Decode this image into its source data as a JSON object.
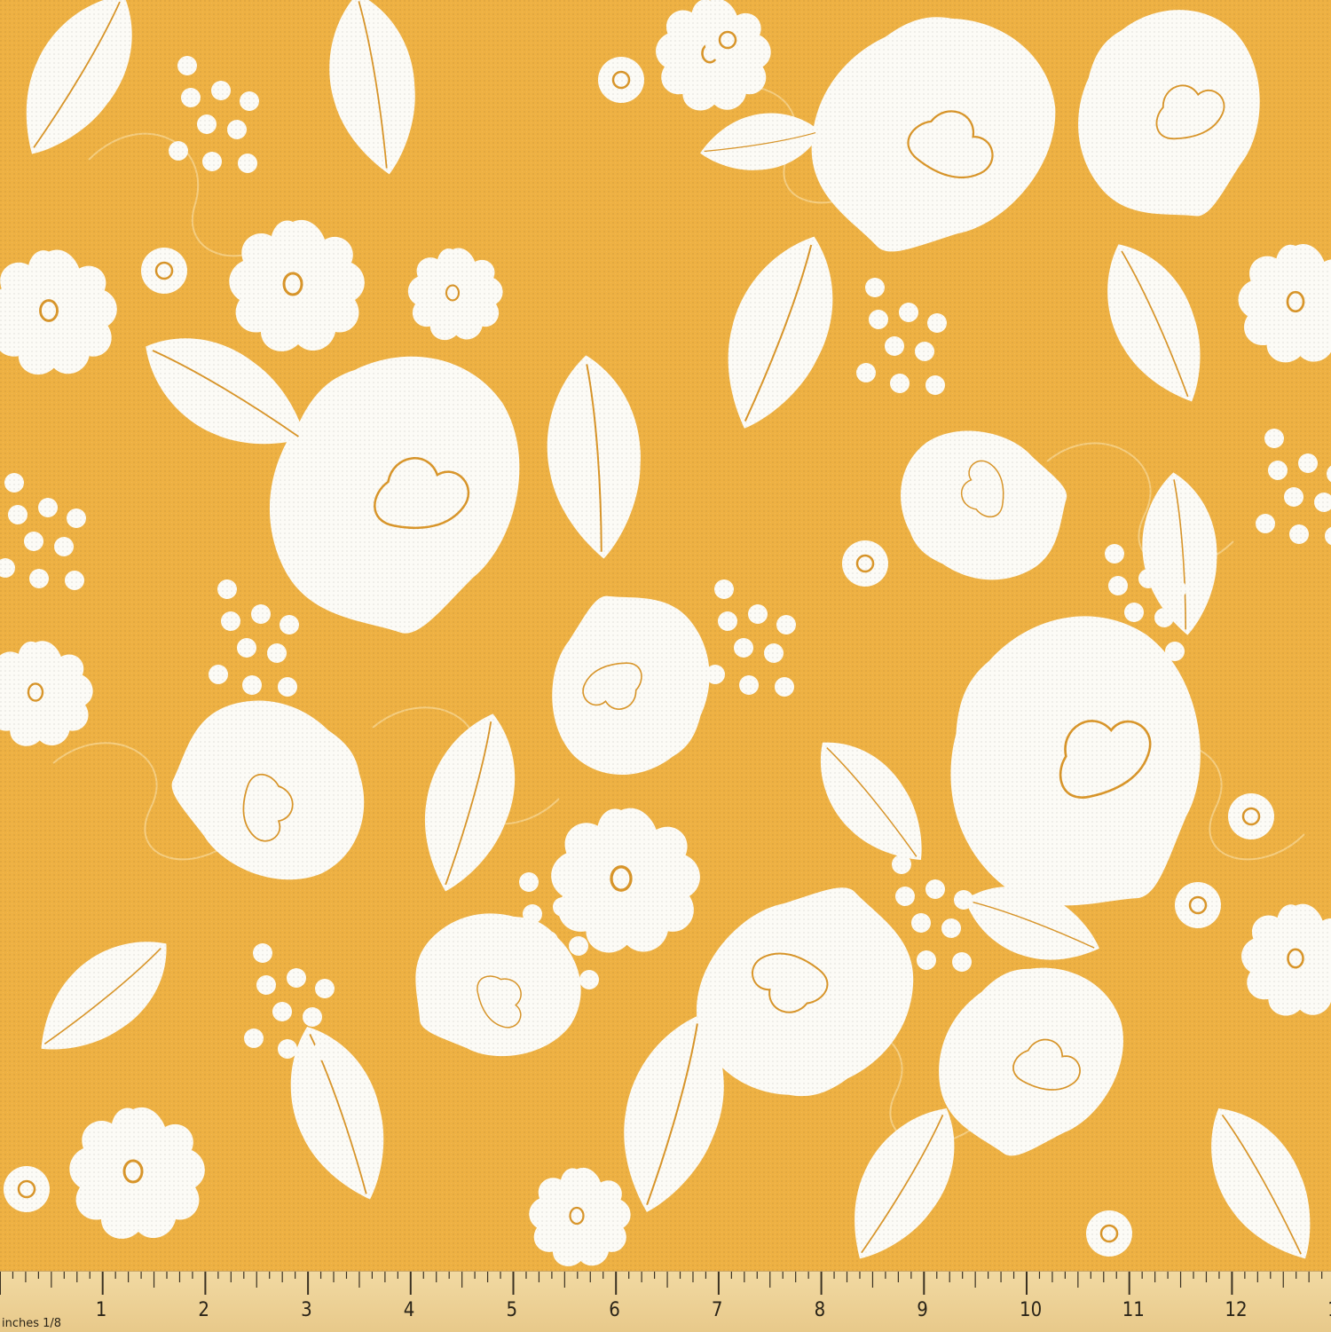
{
  "fabric": {
    "background_color": "#eeb143",
    "motif_color": "#fcfbf6",
    "outline_color": "#d9962a",
    "motifs": [
      "flower-icon",
      "leaf-icon",
      "heart-petal-icon",
      "berry-dot-icon"
    ]
  },
  "ruler": {
    "unit_label": "inches 1/8",
    "numbers": [
      "1",
      "2",
      "3",
      "4",
      "5",
      "6",
      "7",
      "8",
      "9",
      "10",
      "11",
      "12",
      "1"
    ],
    "color": "#ecd198"
  }
}
